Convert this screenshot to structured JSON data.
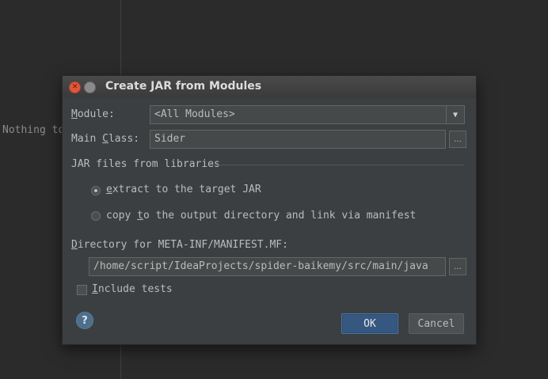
{
  "background": {
    "empty_text": "Nothing to"
  },
  "dialog": {
    "title": "Create JAR from Modules",
    "module_label_first": "M",
    "module_label_rest": "odule:",
    "module_value": "<All Modules>",
    "main_class_label_a": "Main ",
    "main_class_label_u": "C",
    "main_class_label_b": "lass:",
    "main_class_value": "Sider",
    "libraries_group_title": "JAR files from libraries",
    "radio_extract_u": "e",
    "radio_extract_rest": "xtract to the target JAR",
    "radio_copy_a": "copy ",
    "radio_copy_u": "t",
    "radio_copy_b": "o the output directory and link via manifest",
    "manifest_dir_u": "D",
    "manifest_dir_rest": "irectory for META-INF/MANIFEST.MF:",
    "manifest_dir_value": "/home/script/IdeaProjects/spider-baikemy/src/main/java",
    "include_tests_u": "I",
    "include_tests_rest": "nclude tests",
    "ok_label": "OK",
    "cancel_label": "Cancel",
    "browse_label": "...",
    "help_label": "?"
  },
  "state": {
    "selected_option": "extract to the target JAR",
    "include_tests_checked": false
  },
  "colors": {
    "background": "#2b2b2b",
    "dialog": "#3c3f41",
    "accent": "#365880",
    "close_button": "#e0573b",
    "text": "#bbbbbb"
  },
  "icons": {
    "close": "close-icon",
    "minimize": "minimize-icon",
    "dropdown": "chevron-down-icon",
    "help": "help-icon"
  }
}
